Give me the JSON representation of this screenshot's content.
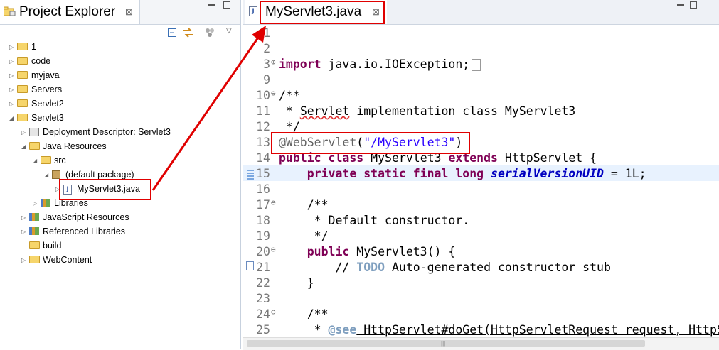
{
  "left_panel": {
    "tab_title": "Project Explorer",
    "tab_close": "⊠",
    "tree": [
      {
        "label": "1",
        "icon": "project-folder-icon",
        "twisty": "▷"
      },
      {
        "label": "code",
        "icon": "project-folder-icon",
        "twisty": "▷"
      },
      {
        "label": "myjava",
        "icon": "project-folder-icon",
        "twisty": "▷"
      },
      {
        "label": "Servers",
        "icon": "project-folder-icon",
        "twisty": "▷"
      },
      {
        "label": "Servlet2",
        "icon": "project-folder-icon",
        "twisty": "▷"
      },
      {
        "label": "Servlet3",
        "icon": "project-folder-icon",
        "twisty": "◢"
      },
      {
        "label": "Deployment Descriptor: Servlet3",
        "icon": "deployment-descriptor-icon",
        "twisty": "▷"
      },
      {
        "label": "Java Resources",
        "icon": "java-resources-icon",
        "twisty": "◢"
      },
      {
        "label": "src",
        "icon": "source-folder-icon",
        "twisty": "◢"
      },
      {
        "label": "(default package)",
        "icon": "package-icon",
        "twisty": "◢"
      },
      {
        "label": "MyServlet3.java",
        "icon": "java-file-icon",
        "twisty": "▷"
      },
      {
        "label": "Libraries",
        "icon": "libraries-icon",
        "twisty": "▷"
      },
      {
        "label": "JavaScript Resources",
        "icon": "javascript-resources-icon",
        "twisty": "▷"
      },
      {
        "label": "Referenced Libraries",
        "icon": "libraries-icon",
        "twisty": "▷"
      },
      {
        "label": "build",
        "icon": "folder-icon",
        "twisty": ""
      },
      {
        "label": "WebContent",
        "icon": "folder-icon",
        "twisty": "▷"
      }
    ]
  },
  "editor": {
    "tab_title": "MyServlet3.java",
    "tab_close": "⊠",
    "file_icon_letter": "J",
    "lines": [
      {
        "num": "1"
      },
      {
        "num": "2"
      },
      {
        "num": "3",
        "fold": "⊕"
      },
      {
        "num": "9"
      },
      {
        "num": "10",
        "fold": "⊖"
      },
      {
        "num": "11"
      },
      {
        "num": "12"
      },
      {
        "num": "13"
      },
      {
        "num": "14"
      },
      {
        "num": "15"
      },
      {
        "num": "16"
      },
      {
        "num": "17",
        "fold": "⊖"
      },
      {
        "num": "18"
      },
      {
        "num": "19"
      },
      {
        "num": "20",
        "fold": "⊖"
      },
      {
        "num": "21"
      },
      {
        "num": "22"
      },
      {
        "num": "23"
      },
      {
        "num": "24",
        "fold": "⊖"
      },
      {
        "num": "25"
      }
    ],
    "code": {
      "l3_kw": "import",
      "l3_rest": " java.io.IOException;",
      "l10": "/**",
      "l11_a": " * ",
      "l11_b": "Servlet",
      "l11_c": " implementation class MyServlet3",
      "l12": " */",
      "l13_an": "@WebServlet",
      "l13_p1": "(",
      "l13_str": "\"/MyServlet3\"",
      "l13_p2": ")",
      "l14_kw1": "public",
      "l14_kw2": "class",
      "l14_name": "MyServlet3",
      "l14_kw3": "extends",
      "l14_rest": "HttpServlet {",
      "l15_kw": "    private static final long ",
      "l15_field": "serialVersionUID",
      "l15_rest": " = 1L;",
      "l17": "    /**",
      "l18": "     * Default constructor.",
      "l19": "     */",
      "l20_kw": "    public",
      "l20_rest": " MyServlet3() {",
      "l21_a": "        // ",
      "l21_todo": "TODO",
      "l21_b": " Auto-generated constructor stub",
      "l22": "    }",
      "l24": "    /**",
      "l25_a": "     * ",
      "l25_tag": "@see",
      "l25_b": " HttpServlet#doGet(HttpServletRequest request, HttpServletResponse response)"
    }
  },
  "colors": {
    "annotation": "#e00000",
    "keyword": "#7f0055",
    "javadoc": "#3f5fbf",
    "string": "#2a00ff",
    "comment": "#3f7f5f"
  }
}
